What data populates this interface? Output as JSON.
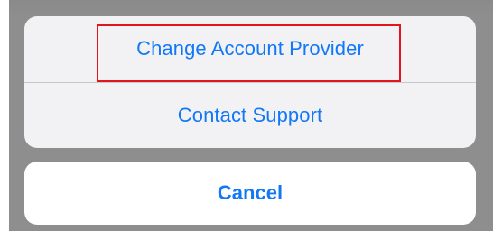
{
  "action_sheet": {
    "actions": [
      {
        "label": "Change Account Provider",
        "highlighted": true
      },
      {
        "label": "Contact Support",
        "highlighted": false
      }
    ],
    "cancel_label": "Cancel"
  },
  "colors": {
    "dimmed_background": "#8e8e8e",
    "action_text": "#1278f6",
    "sheet_background": "#f2f2f4",
    "cancel_background": "#ffffff",
    "highlight_border": "#e3141a"
  }
}
